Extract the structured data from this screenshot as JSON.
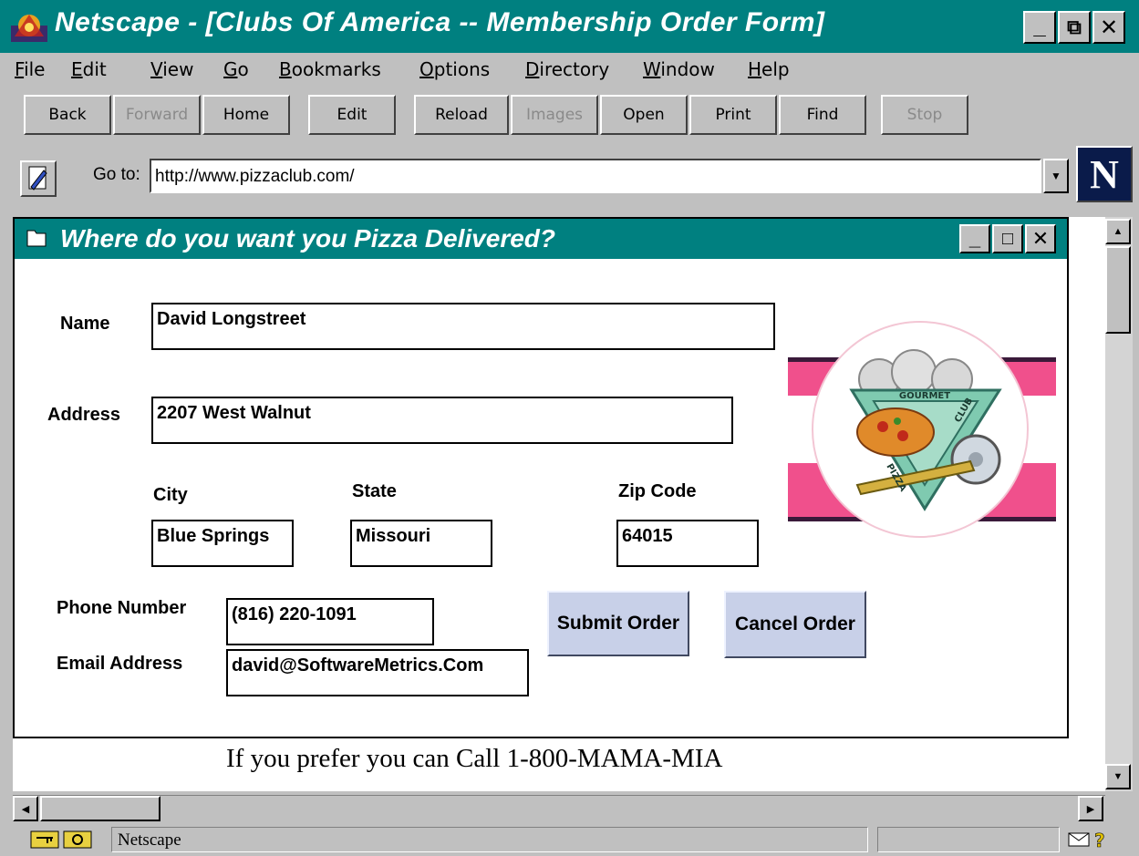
{
  "window": {
    "title": "Netscape - [Clubs Of America -- Membership Order Form]",
    "controls": [
      "_",
      "⧉",
      "✕"
    ]
  },
  "menu": [
    {
      "key": "F",
      "rest": "ile"
    },
    {
      "key": "E",
      "rest": "dit"
    },
    {
      "key": "V",
      "rest": "iew"
    },
    {
      "key": "G",
      "rest": "o"
    },
    {
      "key": "B",
      "rest": "ookmarks"
    },
    {
      "key": "O",
      "rest": "ptions"
    },
    {
      "key": "D",
      "rest": "irectory"
    },
    {
      "key": "W",
      "rest": "indow"
    },
    {
      "key": "H",
      "rest": "elp"
    }
  ],
  "toolbar": {
    "back": "Back",
    "forward": "Forward",
    "home": "Home",
    "edit": "Edit",
    "reload": "Reload",
    "images": "Images",
    "open": "Open",
    "print": "Print",
    "find": "Find",
    "stop": "Stop"
  },
  "location": {
    "label": "Go to:",
    "url": "http://www.pizzaclub.com/",
    "logo": "N"
  },
  "inner_window": {
    "title": "Where do you want you Pizza Delivered?",
    "controls": [
      "_",
      "□",
      "✕"
    ]
  },
  "form": {
    "name_label": "Name",
    "name_value": "David Longstreet",
    "address_label": "Address",
    "address_value": "2207 West Walnut",
    "city_label": "City",
    "city_value": "Blue Springs",
    "state_label": "State",
    "state_value": "Missouri",
    "zip_label": "Zip Code",
    "zip_value": "64015",
    "phone_label": "Phone Number",
    "phone_value": "(816) 220-1091",
    "email_label": "Email Address",
    "email_value": "david@SoftwareMetrics.Com",
    "submit": "Submit Order",
    "cancel": "Cancel Order"
  },
  "logo": {
    "top_text": "GOURMET",
    "left_text": "PIZZA",
    "right_text": "CLUB"
  },
  "call_text": "If you prefer you can Call 1-800-MAMA-MIA",
  "status": {
    "text": "Netscape"
  },
  "colors": {
    "titlebar": "#008080",
    "chrome": "#c0c0c0",
    "button": "#c8d0e8",
    "stripe": "#f0508c"
  }
}
